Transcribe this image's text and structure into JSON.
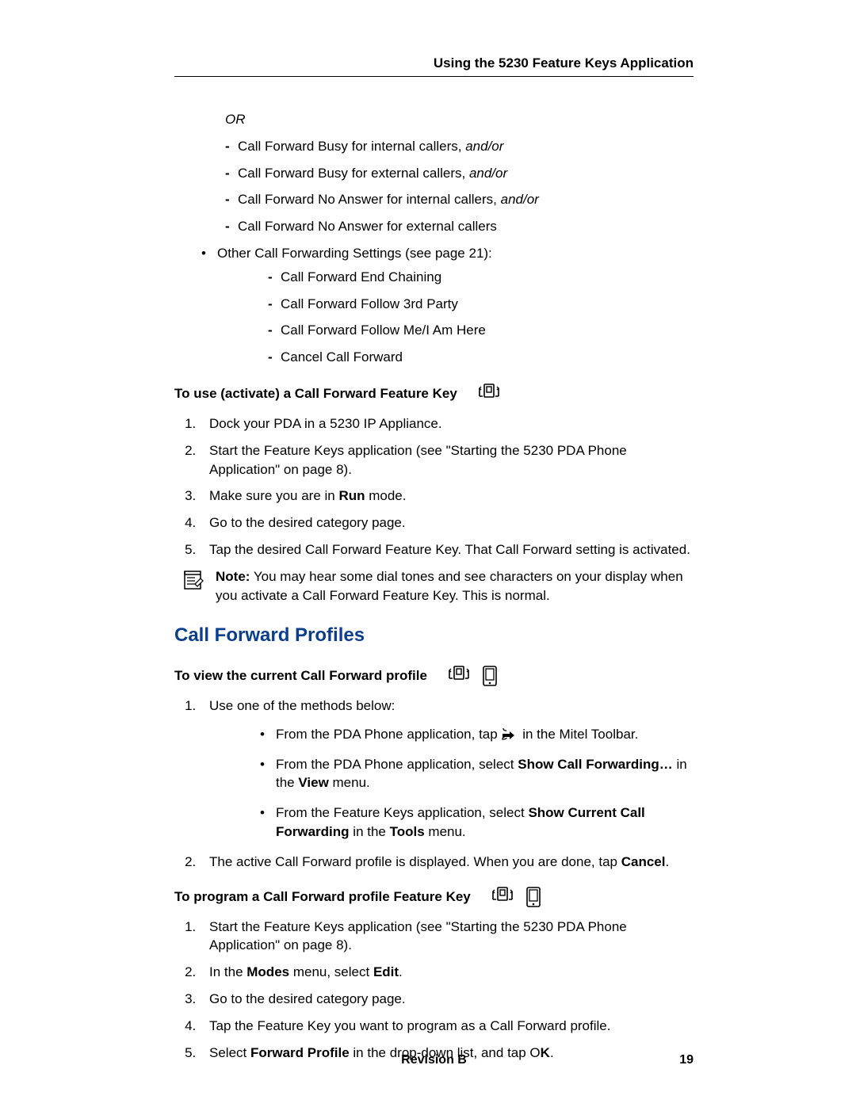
{
  "header": {
    "title": "Using the 5230 Feature Keys Application"
  },
  "intro": {
    "or": "OR",
    "dash1_a": "Call Forward Busy for internal callers, ",
    "dash1_b": "and/or",
    "dash2_a": "Call Forward Busy for external callers, ",
    "dash2_b": "and/or",
    "dash3_a": "Call Forward No Answer for internal callers, ",
    "dash3_b": "and/or",
    "dash4": "Call Forward No Answer for external callers",
    "other": "Other Call Forwarding Settings (see page 21):",
    "oth1": "Call Forward End Chaining",
    "oth2": "Call Forward Follow 3rd Party",
    "oth3": "Call Forward Follow Me/I Am Here",
    "oth4": "Cancel Call Forward"
  },
  "activate": {
    "heading": "To use (activate) a Call Forward Feature Key",
    "s1": "Dock your PDA in a 5230 IP Appliance.",
    "s2": "Start the Feature Keys application (see \"Starting the 5230 PDA Phone Application\" on page 8).",
    "s3a": "Make sure you are in ",
    "s3b": "Run",
    "s3c": " mode.",
    "s4": "Go to the desired category page.",
    "s5": "Tap the desired Call Forward Feature Key. That Call Forward setting is activated.",
    "note_label": "Note:",
    "note_text": " You may hear some dial tones and see characters on your display when you activate a Call Forward Feature Key. This is normal."
  },
  "profiles": {
    "title": "Call Forward Profiles",
    "view_heading": "To view the current Call Forward profile",
    "v1": "Use one of the methods below:",
    "v1a_pre": "From the PDA Phone application, tap ",
    "v1a_post": " in the Mitel Toolbar.",
    "v1b_pre": "From the PDA Phone application, select ",
    "v1b_bold": "Show Call Forwarding…",
    "v1b_mid": " in the ",
    "v1b_bold2": "View",
    "v1b_post": " menu.",
    "v1c_pre": "From the Feature Keys application, select ",
    "v1c_bold": "Show Current Call Forwarding",
    "v1c_mid": " in the ",
    "v1c_bold2": "Tools",
    "v1c_post": " menu.",
    "v2_pre": "The active Call Forward profile is displayed. When you are done, tap ",
    "v2_bold": "Cancel",
    "v2_post": ".",
    "prog_heading": "To program a Call Forward profile Feature Key",
    "p1": "Start the Feature Keys application (see \"Starting the 5230 PDA Phone Application\" on page 8).",
    "p2_pre": "In the ",
    "p2_bold": "Modes",
    "p2_mid": " menu, select ",
    "p2_bold2": "Edit",
    "p2_post": ".",
    "p3": "Go to the desired category page.",
    "p4": "Tap the Feature Key you want to program as a Call Forward profile.",
    "p5_pre": "Select ",
    "p5_bold": "Forward Profile",
    "p5_mid": " in the drop-down list, and tap O",
    "p5_bold2": "K",
    "p5_post": "."
  },
  "footer": {
    "revision": "Revision B",
    "page": "19"
  }
}
